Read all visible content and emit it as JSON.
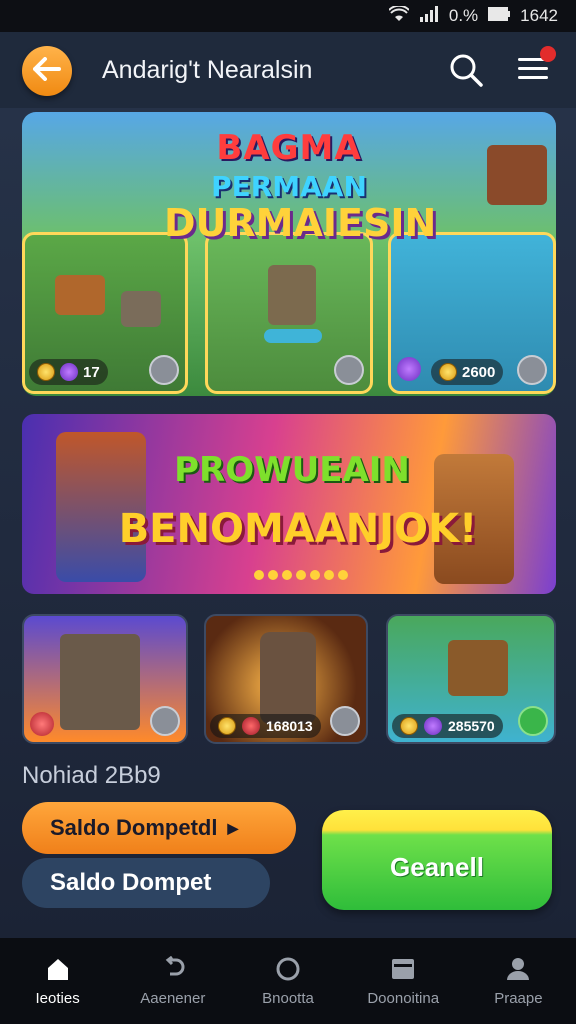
{
  "status_bar": {
    "battery_text": "0.%",
    "time": "1642"
  },
  "header": {
    "title": "Andarig't Nearalsin"
  },
  "banner_top": {
    "title_line1": "BAGMA",
    "title_line2": "PERMAAN",
    "title_line3": "DURMAIESIN",
    "left_chip_value": "17",
    "right_chip_value": "2600"
  },
  "banner_promo": {
    "line1": "PROWUEAIN",
    "line2": "BENOMAANJOK!"
  },
  "thumbnails": [
    {
      "value": "",
      "icon": "shield-badge-icon"
    },
    {
      "value": "168013",
      "icon": "gem-icon"
    },
    {
      "value": "285570",
      "icon": "coin-icon"
    }
  ],
  "balance": {
    "label": "Nohiad 2Bb9"
  },
  "buttons": {
    "saldo_primary": "Saldo Dompetdl",
    "saldo_secondary": "Saldo Dompet",
    "green": "Geanell"
  },
  "nav": [
    {
      "label": "Ieoties",
      "icon": "home-icon"
    },
    {
      "label": "Aaenener",
      "icon": "refresh-icon"
    },
    {
      "label": "Bnootta",
      "icon": "circle-icon"
    },
    {
      "label": "Doonoitina",
      "icon": "wallet-icon"
    },
    {
      "label": "Praape",
      "icon": "person-icon"
    }
  ]
}
